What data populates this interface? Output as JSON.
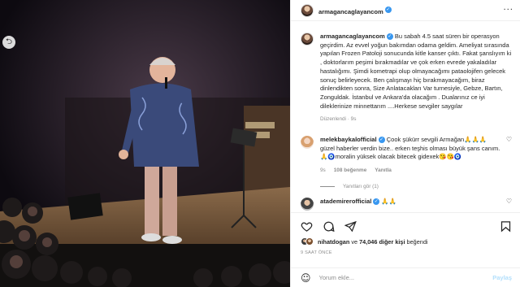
{
  "post": {
    "author": "armagancaglayancom",
    "caption": "Bu sabah 4.5 saat süren bir operasyon geçirdim. Az evvel yoğun bakımdan odama geldim. Ameliyat sırasında yapılan Frozen Patoloji sonucunda kitle kanser çıktı. Fakat şanslıyım ki , doktorlarım peşimi bırakmadılar ve çok erken evrede yakaladılar hastalığımı. Şimdi kometrapi olup olmayacağımı pataolojifen gelecek sonuç belirleyecek. Ben çalışmayı hiç bırakmayacağım, biraz dinlendikten sonra, Size Anlatacakları Var turnesiyle, Gebze, Bartın, Zonguldak. İstanbul ve Ankara'da olacağım . Dualarınız ce iyi dileklerinize minnettarım ....Herkese sevgiler saygılar",
    "caption_meta": "Düzenlendi · 9s"
  },
  "comments": [
    {
      "user": "melekbaykalofficial",
      "text": "Çook şükürr sevgili Armağan🙏🙏🙏 güzel haberler verdin bize.. erken teşhis olması büyük şans canım.🙏🧿moralin yüksek olacak bitecek gidexek😘😘🧿",
      "time": "9s",
      "likes": "108 beğenme",
      "reply": "Yanıtla",
      "replies_label": "Yanıtları gör (1)"
    },
    {
      "user": "atademirerofficial",
      "text": "🙏🙏",
      "time": "",
      "likes": "",
      "reply": ""
    }
  ],
  "likes": {
    "liker": "nihatdogan",
    "text_middle": "ve",
    "count_text": "74,046 diğer kişi",
    "text_end": "beğendi"
  },
  "timestamp": "9 SAAT ÖNCE",
  "comment_box": {
    "placeholder": "Yorum ekle...",
    "share_label": "Paylaş"
  },
  "icons": {
    "more": "more-horizontal-icon",
    "like": "heart-icon",
    "comment": "comment-icon",
    "share": "send-icon",
    "save": "bookmark-icon",
    "emoji": "smiley-icon",
    "verified": "verified-badge-icon",
    "photo_prev": "chevron-left-icon"
  },
  "colors": {
    "verified": "#3897f0",
    "muted_text": "#8e8e8e",
    "share_disabled": "#b2dffc"
  }
}
